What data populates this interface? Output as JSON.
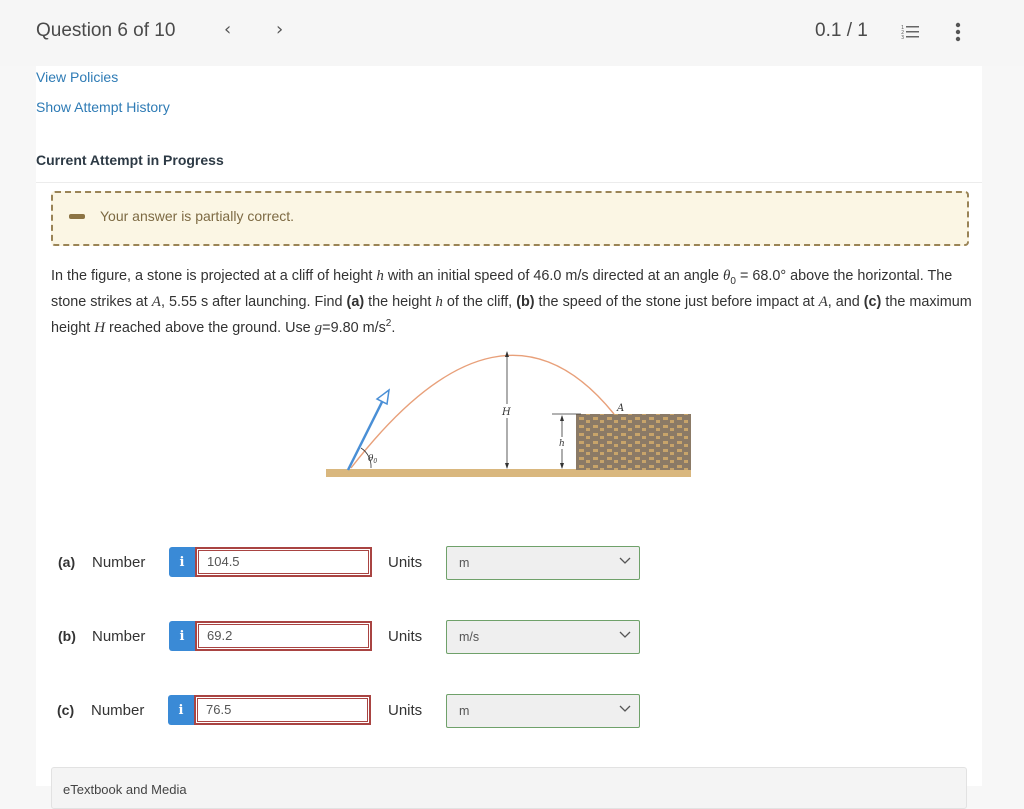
{
  "header": {
    "question_title": "Question 6 of 10",
    "prev_glyph": "‹",
    "next_glyph": "›",
    "score": "0.1 / 1"
  },
  "links": {
    "view_policies": "View Policies",
    "show_attempt_history": "Show Attempt History"
  },
  "attempt": {
    "heading": "Current Attempt in Progress"
  },
  "feedback": {
    "status": "partial",
    "message": "Your answer is partially correct."
  },
  "problem": {
    "seg1": "In the figure, a stone is projected at a cliff of height ",
    "var_h": "h",
    "seg2": " with an initial speed of 46.0 m/s directed at an angle ",
    "theta": "θ",
    "theta_sub": "0",
    "seg3": " = 68.0° above the horizontal. The stone strikes at ",
    "var_A": "A",
    "seg4": ", 5.55 s after launching. Find ",
    "part_a": "(a)",
    "seg5": " the height ",
    "var_h2": "h",
    "seg6": " of the cliff, ",
    "part_b": "(b)",
    "seg7": " the speed of the stone just before impact at ",
    "var_A2": "A",
    "seg8": ", and ",
    "part_c": "(c)",
    "seg9": " the maximum height ",
    "var_H": "H",
    "seg10": " reached above the ground. Use ",
    "var_g": "g",
    "seg11": "=9.80 m/s",
    "exp": "2",
    "seg12": "."
  },
  "figure": {
    "label_H": "H",
    "label_h": "h",
    "label_A": "A",
    "label_theta": "θ",
    "label_theta_sub": "0"
  },
  "answers": [
    {
      "part": "(a)",
      "number_label": "Number",
      "value": "104.5",
      "units_label": "Units",
      "unit": "m"
    },
    {
      "part": "(b)",
      "number_label": "Number",
      "value": "69.2",
      "units_label": "Units",
      "unit": "m/s"
    },
    {
      "part": "(c)",
      "number_label": "Number",
      "value": "76.5",
      "units_label": "Units",
      "unit": "m"
    }
  ],
  "info_glyph": "i",
  "textbook": {
    "label": "eTextbook and Media"
  },
  "colors": {
    "link": "#2e7bb5",
    "info_button": "#3a8ad6",
    "incorrect_border": "#a94442",
    "unit_border": "#6fa16a",
    "feedback_bg": "#fbf6e4",
    "feedback_border": "#9a8456",
    "trajectory": "#e8a07a",
    "velocity_arrow": "#4a8fd6"
  }
}
